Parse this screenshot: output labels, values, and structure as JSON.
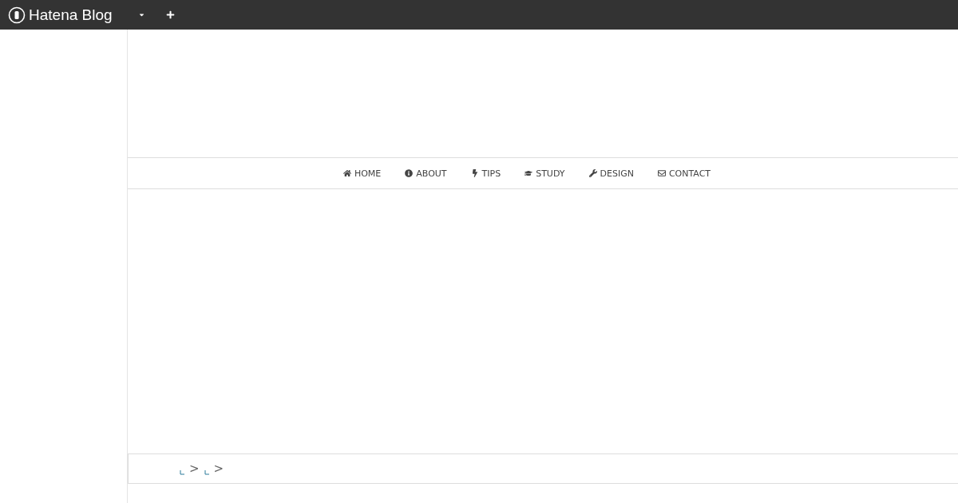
{
  "topbar": {
    "logo_text": "Hatena Blog",
    "menu": [
      {
        "kind": "dropdown"
      },
      {
        "kind": "add"
      }
    ]
  },
  "nav": [
    {
      "label": "HOME"
    },
    {
      "label": "ABOUT"
    },
    {
      "label": "TIPS"
    },
    {
      "label": "STUDY"
    },
    {
      "label": "DESIGN"
    },
    {
      "label": "CONTACT"
    }
  ],
  "breadcrumb": [
    {
      "separator": ">"
    },
    {
      "separator": ">"
    }
  ]
}
